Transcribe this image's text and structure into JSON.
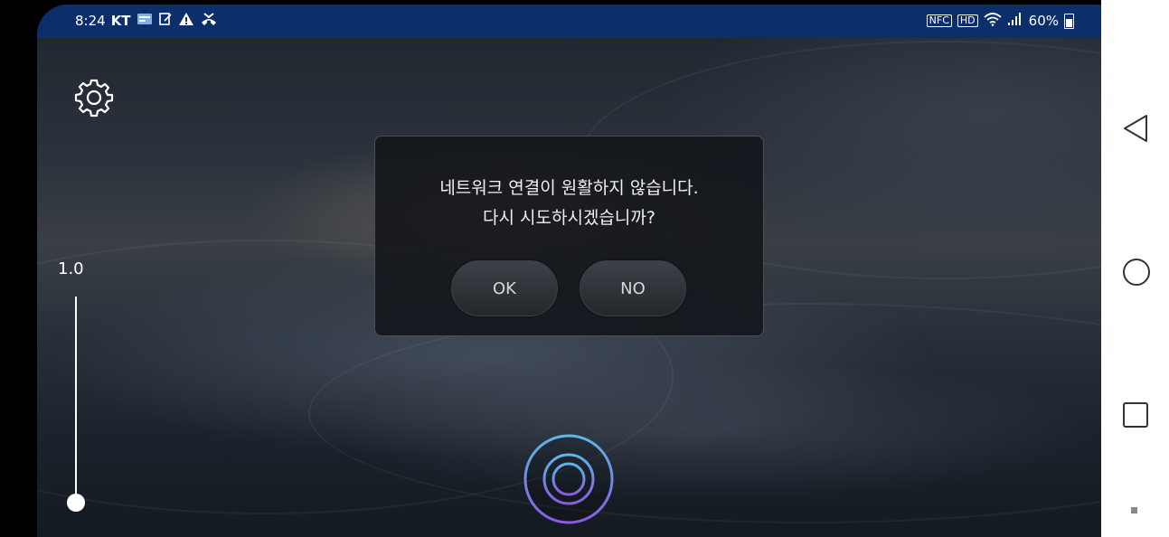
{
  "status_bar": {
    "time": "8:24",
    "carrier": "KT",
    "left_icons": [
      "card-notification-icon",
      "note-icon",
      "warning-icon",
      "missed-call-icon"
    ],
    "right_icons": [
      "nfc-icon",
      "hd-voice-icon",
      "wifi-icon",
      "signal-icon"
    ],
    "nfc_text": "NFC",
    "hd_text": "HD",
    "battery_text": "60%",
    "battery_level": 0.6
  },
  "camera": {
    "settings_icon": "gear-icon",
    "zoom_value": "1.0",
    "zoom_level": 0.0
  },
  "dialog": {
    "message_line1": "네트워크 연결이 원활하지 않습니다.",
    "message_line2": "다시 시도하시겠습니까?",
    "ok_label": "OK",
    "no_label": "NO"
  },
  "mic_button": {
    "icon": "voice-ring-icon",
    "accent": "#5bb8e8",
    "accent2": "#8a5be0"
  },
  "nav_bar": {
    "back_icon": "triangle-back-icon",
    "home_icon": "circle-home-icon",
    "recents_icon": "square-recents-icon",
    "extra_icon": "small-square-icon"
  },
  "colors": {
    "status_bar_bg": "#0c2f6b",
    "nav_bar_bg": "#ffffff"
  }
}
